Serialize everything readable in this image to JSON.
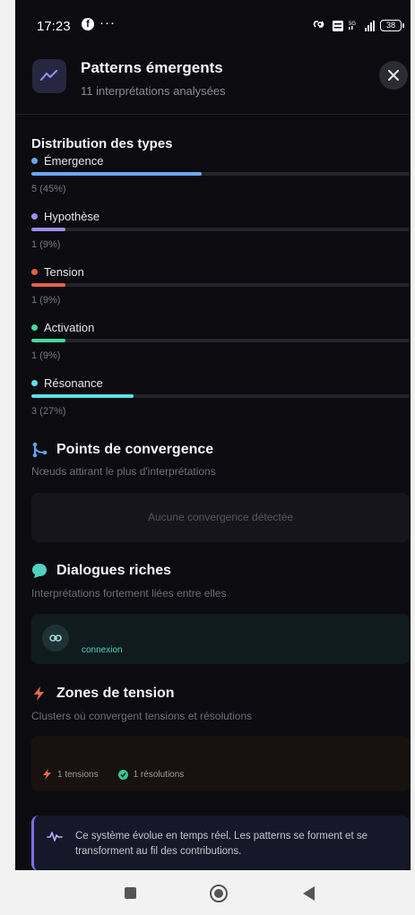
{
  "status_bar": {
    "time": "17:23",
    "fb_glyph": "f",
    "more": "···",
    "battery": "38"
  },
  "header": {
    "title": "Patterns émergents",
    "subtitle": "11 interprétations analysées",
    "icon": "trending-chart-icon",
    "close_icon": "close-icon"
  },
  "distribution": {
    "title": "Distribution des types",
    "items": [
      {
        "label": "Émergence",
        "count": "5 (45%)",
        "fraction": 0.45,
        "color": "#6ba7f5"
      },
      {
        "label": "Hypothèse",
        "count": "1 (9%)",
        "fraction": 0.09,
        "color": "#a18cf2"
      },
      {
        "label": "Tension",
        "count": "1 (9%)",
        "fraction": 0.09,
        "color": "#e5624c"
      },
      {
        "label": "Activation",
        "count": "1 (9%)",
        "fraction": 0.09,
        "color": "#3fdc9f"
      },
      {
        "label": "Résonance",
        "count": "3 (27%)",
        "fraction": 0.27,
        "color": "#5ce1e6"
      }
    ]
  },
  "convergence": {
    "title": "Points de convergence",
    "description": "Nœuds attirant le plus d'interprétations",
    "empty": "Aucune convergence détectée",
    "icon": "merge-icon",
    "icon_color": "#5aa5f5"
  },
  "dialogues": {
    "title": "Dialogues riches",
    "description": "Interprétations fortement liées entre elles",
    "link_label": "connexion",
    "icon": "chat-bubble-icon",
    "icon_color": "#4fd3be"
  },
  "tension_zones": {
    "title": "Zones de tension",
    "description": "Clusters où convergent tensions et résolutions",
    "tensions": "1 tensions",
    "resolutions": "1 résolutions",
    "icon": "lightning-icon",
    "icon_color": "#f06a4d"
  },
  "info": {
    "text": "Ce système évolue en temps réel. Les patterns se forment et se transforment au fil des contributions.",
    "icon": "activity-pulse-icon"
  },
  "navigation": {
    "recent_icon": "recent-apps-icon",
    "home_icon": "home-icon",
    "back_icon": "back-icon"
  }
}
